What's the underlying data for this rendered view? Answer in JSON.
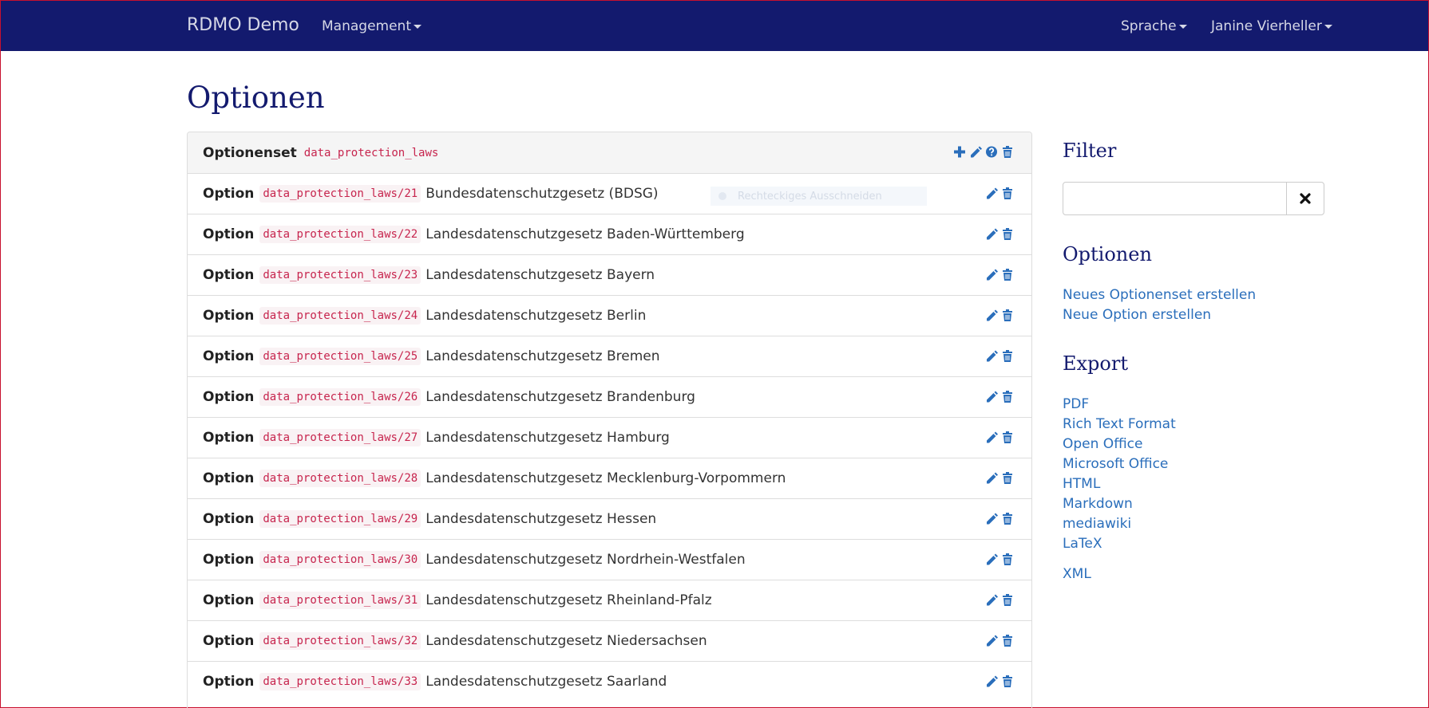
{
  "navbar": {
    "brand": "RDMO Demo",
    "management": "Management",
    "language": "Sprache",
    "user": "Janine Vierheller"
  },
  "page_title": "Optionen",
  "optionset": {
    "type_label": "Optionenset",
    "key": "data_protection_laws"
  },
  "options": [
    {
      "type_label": "Option",
      "key": "data_protection_laws/21",
      "text": "Bundesdatenschutzgesetz (BDSG)"
    },
    {
      "type_label": "Option",
      "key": "data_protection_laws/22",
      "text": "Landesdatenschutzgesetz Baden-Württemberg"
    },
    {
      "type_label": "Option",
      "key": "data_protection_laws/23",
      "text": "Landesdatenschutzgesetz Bayern"
    },
    {
      "type_label": "Option",
      "key": "data_protection_laws/24",
      "text": "Landesdatenschutzgesetz Berlin"
    },
    {
      "type_label": "Option",
      "key": "data_protection_laws/25",
      "text": "Landesdatenschutzgesetz Bremen"
    },
    {
      "type_label": "Option",
      "key": "data_protection_laws/26",
      "text": "Landesdatenschutzgesetz Brandenburg"
    },
    {
      "type_label": "Option",
      "key": "data_protection_laws/27",
      "text": "Landesdatenschutzgesetz Hamburg"
    },
    {
      "type_label": "Option",
      "key": "data_protection_laws/28",
      "text": "Landesdatenschutzgesetz Mecklenburg-Vorpommern"
    },
    {
      "type_label": "Option",
      "key": "data_protection_laws/29",
      "text": "Landesdatenschutzgesetz Hessen"
    },
    {
      "type_label": "Option",
      "key": "data_protection_laws/30",
      "text": "Landesdatenschutzgesetz Nordrhein-Westfalen"
    },
    {
      "type_label": "Option",
      "key": "data_protection_laws/31",
      "text": "Landesdatenschutzgesetz Rheinland-Pfalz"
    },
    {
      "type_label": "Option",
      "key": "data_protection_laws/32",
      "text": "Landesdatenschutzgesetz Niedersachsen"
    },
    {
      "type_label": "Option",
      "key": "data_protection_laws/33",
      "text": "Landesdatenschutzgesetz Saarland"
    }
  ],
  "overlay": {
    "snip_label": "Rechteckiges Ausschneiden"
  },
  "sidebar": {
    "filter_heading": "Filter",
    "filter_value": "",
    "options_heading": "Optionen",
    "new_optionset": "Neues Optionenset erstellen",
    "new_option": "Neue Option erstellen",
    "export_heading": "Export",
    "export_links": [
      "PDF",
      "Rich Text Format",
      "Open Office",
      "Microsoft Office",
      "HTML",
      "Markdown",
      "mediawiki",
      "LaTeX"
    ],
    "xml_link": "XML"
  },
  "colors": {
    "navbar": "#131a6e",
    "heading": "#131a6e",
    "link": "#2a6ebb",
    "code": "#c7254e"
  },
  "icons": {
    "add": "plus-icon",
    "edit": "pencil-icon",
    "help": "question-icon",
    "delete": "trash-icon",
    "clear": "close-icon"
  }
}
